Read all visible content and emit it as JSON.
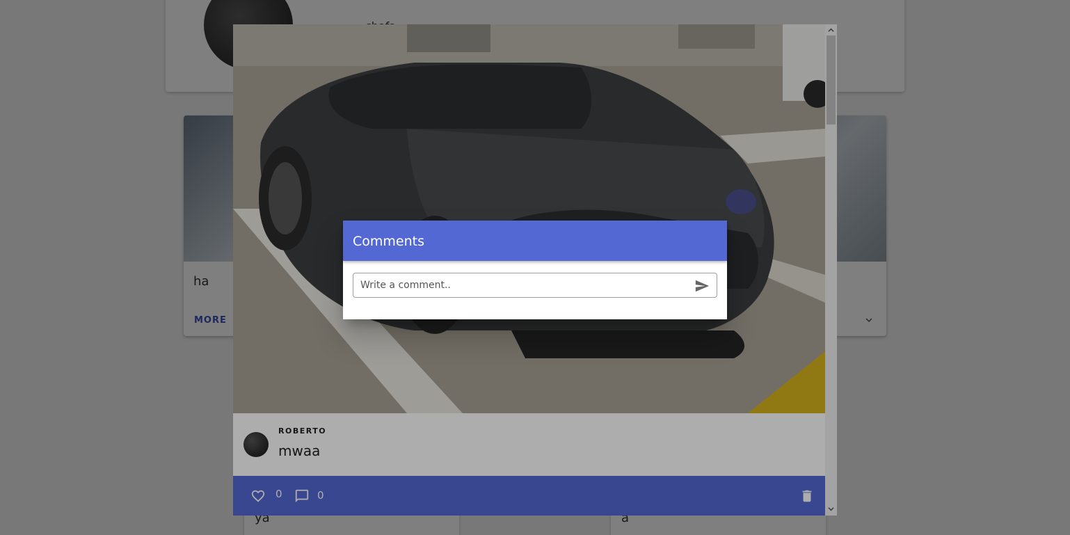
{
  "background": {
    "profile": {
      "name": "chafa"
    },
    "posts": [
      {
        "text": "ha",
        "more_label": "MORE"
      },
      {
        "text": ""
      }
    ],
    "bottom_posts": [
      {
        "text": "ya"
      },
      {
        "text": "a"
      }
    ]
  },
  "viewer": {
    "post": {
      "author": "ROBERTO",
      "caption": "mwaa",
      "likes": "0",
      "comments_count": "0"
    },
    "icons": {
      "like": "heart-outline-icon",
      "comment": "comment-icon",
      "delete": "trash-icon"
    }
  },
  "comments_dialog": {
    "title": "Comments",
    "input_placeholder": "Write a comment..",
    "input_value": "",
    "send_icon": "send-icon"
  },
  "colors": {
    "accent": "#5468d4",
    "more_link": "#3f51b5"
  }
}
